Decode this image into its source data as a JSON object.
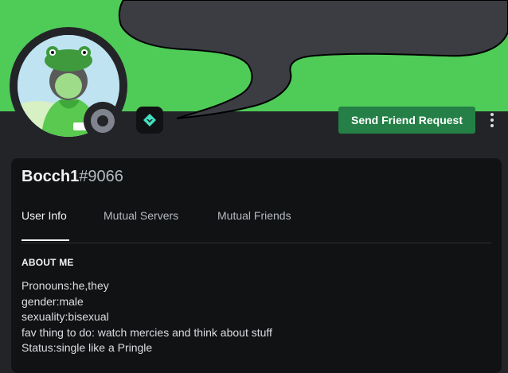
{
  "profile": {
    "username": "Bocch1",
    "discriminator": "#9066",
    "status": "offline",
    "banner_color": "#4fcb57"
  },
  "actions": {
    "friend_request_label": "Send Friend Request",
    "more_icon": "kebab-menu-icon"
  },
  "badges": [
    "hypesquad-balance-icon"
  ],
  "tabs": [
    {
      "label": "User Info",
      "active": true
    },
    {
      "label": "Mutual Servers",
      "active": false
    },
    {
      "label": "Mutual Friends",
      "active": false
    }
  ],
  "about": {
    "title": "ABOUT ME",
    "lines": [
      "Pronouns:he,they",
      "gender:male",
      "sexuality:bisexual",
      "fav thing to do: watch mercies and think about stuff",
      "Status:single like a Pringle"
    ]
  }
}
